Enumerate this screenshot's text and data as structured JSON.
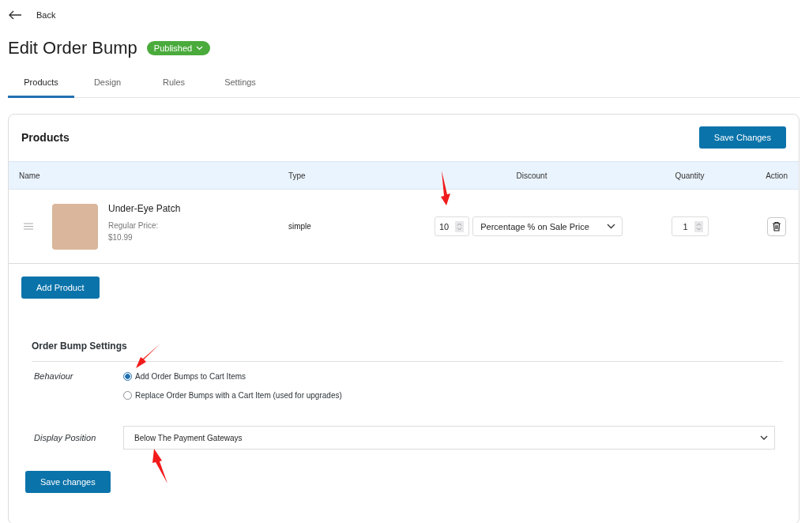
{
  "back": {
    "label": "Back"
  },
  "title": "Edit Order Bump",
  "status": {
    "label": "Published"
  },
  "tabs": [
    {
      "label": "Products",
      "selected": true
    },
    {
      "label": "Design",
      "selected": false
    },
    {
      "label": "Rules",
      "selected": false
    },
    {
      "label": "Settings",
      "selected": false
    }
  ],
  "products": {
    "title": "Products",
    "save_button": "Save Changes",
    "columns": [
      "Name",
      "Type",
      "Discount",
      "Quantity",
      "Action"
    ],
    "rows": [
      {
        "name": "Under-Eye Patch",
        "price_label": "Regular Price:",
        "price": "$10.99",
        "type": "simple",
        "discount_value": "10",
        "discount_type": "Percentage % on Sale Price",
        "quantity": "1"
      }
    ],
    "add_button": "Add Product"
  },
  "settings": {
    "title": "Order Bump Settings",
    "behaviour_label": "Behaviour",
    "behaviour_options": [
      {
        "label": "Add Order Bumps to Cart Items",
        "selected": true
      },
      {
        "label": "Replace Order Bumps with a Cart Item (used for upgrades)",
        "selected": false
      }
    ],
    "position_label": "Display Position",
    "position_value": "Below The Payment Gateways",
    "save_button": "Save changes"
  }
}
